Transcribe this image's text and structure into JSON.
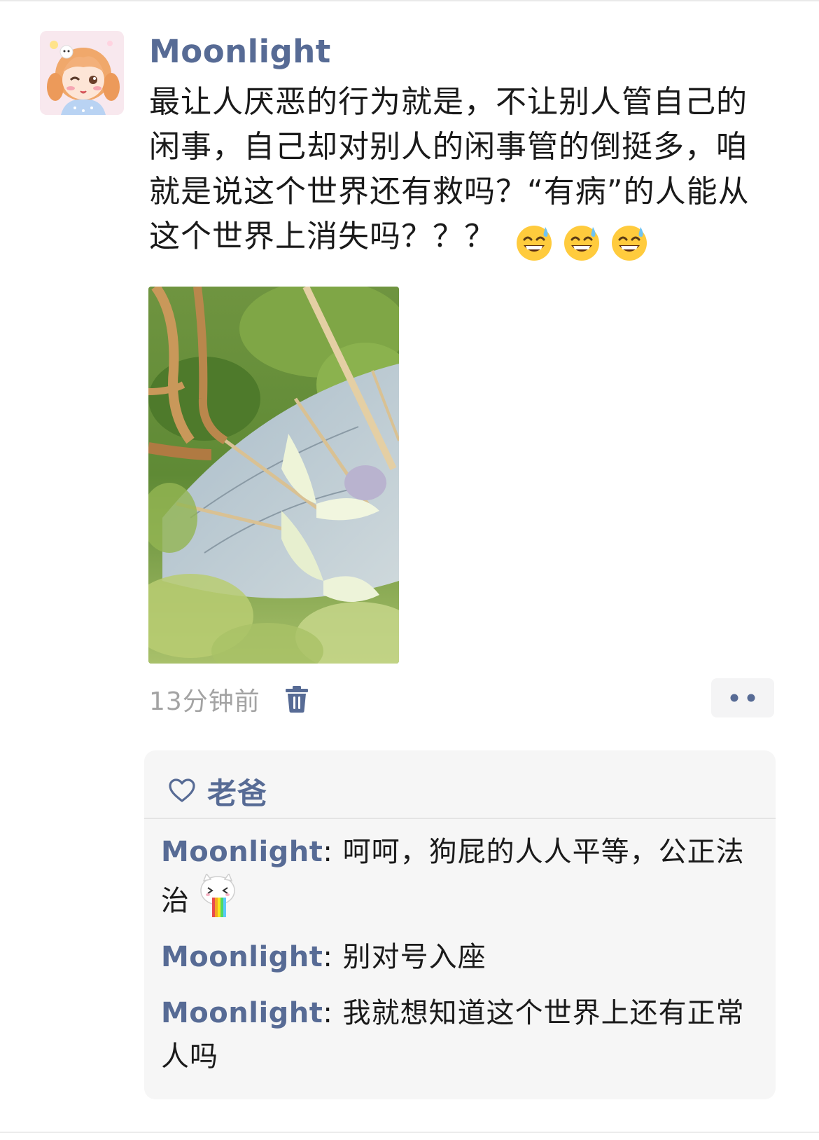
{
  "post": {
    "author": "Moonlight",
    "text": "最让人厌恶的行为就是，不让别人管自己的闲事，自己却对别人的闲事管的倒挺多，咱就是说这个世界还有救吗？“有病”的人能从这个世界上消失吗？？？",
    "emojis": [
      "sweat-smile-emoji",
      "sweat-smile-emoji",
      "sweat-smile-emoji"
    ],
    "timestamp": "13分钟前"
  },
  "likes": {
    "names": [
      "老爸"
    ]
  },
  "comments": [
    {
      "author": "Moonlight",
      "separator": ":",
      "text": " 呵呵，狗屁的人人平等，公正法治",
      "sticker": "rainbow-vomit-cat-sticker"
    },
    {
      "author": "Moonlight",
      "separator": ":",
      "text": " 别对号入座"
    },
    {
      "author": "Moonlight",
      "separator": ":",
      "text": " 我就想知道这个世界上还有正常人吗"
    }
  ],
  "colors": {
    "name": "#576b95",
    "timestamp": "#a3a3a3",
    "panel_bg": "#f6f6f6",
    "text": "#1a1a1a"
  }
}
